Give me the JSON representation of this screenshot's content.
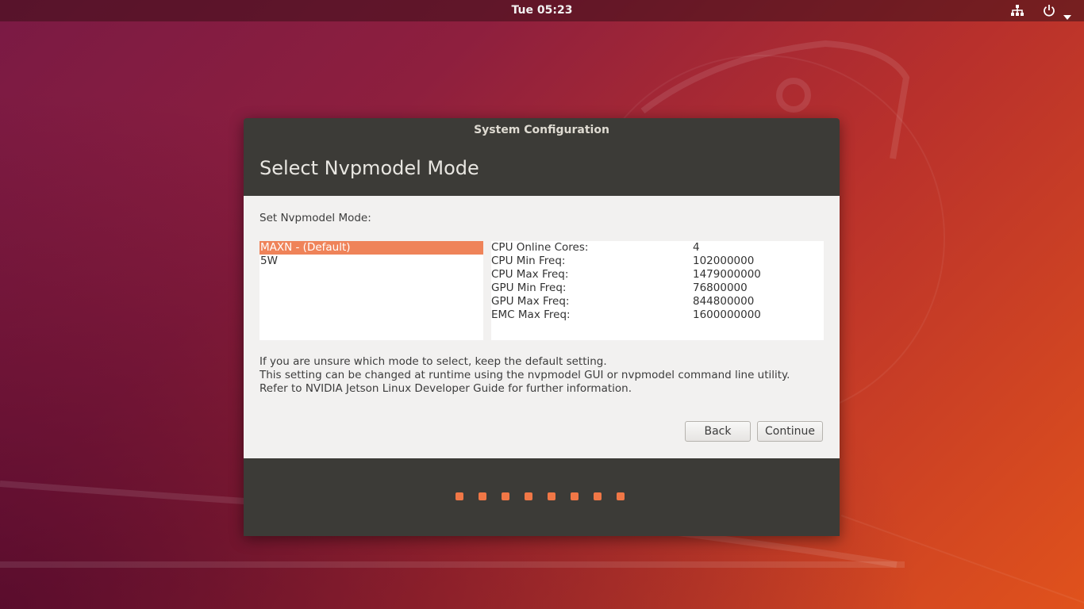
{
  "topbar": {
    "clock": "Tue 05:23",
    "icons": [
      "network-icon",
      "power-icon",
      "chevron-down-icon"
    ]
  },
  "dialog": {
    "title": "System Configuration",
    "heading": "Select Nvpmodel Mode",
    "prompt": "Set Nvpmodel Mode:",
    "modes": [
      {
        "label": "MAXN - (Default)",
        "selected": true
      },
      {
        "label": "5W",
        "selected": false
      }
    ],
    "specs": [
      {
        "label": "CPU Online Cores:",
        "value": "4"
      },
      {
        "label": "CPU Min Freq:",
        "value": "102000000"
      },
      {
        "label": "CPU Max Freq:",
        "value": "1479000000"
      },
      {
        "label": "GPU Min Freq:",
        "value": "76800000"
      },
      {
        "label": "GPU Max Freq:",
        "value": "844800000"
      },
      {
        "label": "EMC Max Freq:",
        "value": "1600000000"
      }
    ],
    "info_lines": [
      "If you are unsure which mode to select, keep the default setting.",
      "This setting can be changed at runtime using the nvpmodel GUI or nvpmodel command line utility.",
      "Refer to NVIDIA Jetson Linux Developer Guide for further information."
    ],
    "buttons": {
      "back": "Back",
      "continue": "Continue"
    },
    "progress_step_count": 8
  },
  "colors": {
    "accent": "#ef8359",
    "dialog_dark": "#3c3b37",
    "content_bg": "#f2f1f0",
    "progress_dot": "#f07746"
  }
}
